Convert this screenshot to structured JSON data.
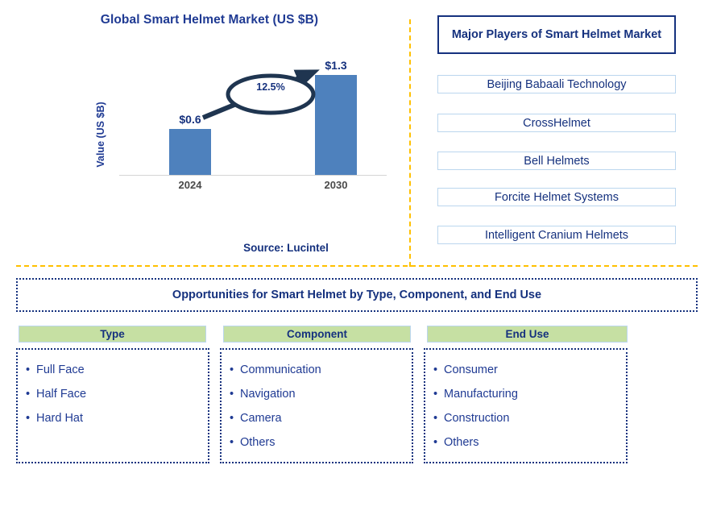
{
  "chart_panel": {
    "title": "Global Smart Helmet Market (US $B)",
    "y_axis_label": "Value (US $B)",
    "cagr_label": "12.5%",
    "source": "Source: Lucintel"
  },
  "chart_data": {
    "type": "bar",
    "title": "Global Smart Helmet Market (US $B)",
    "categories": [
      "2024",
      "2030"
    ],
    "values": [
      0.6,
      1.3
    ],
    "value_labels": [
      "$0.6",
      "$1.3"
    ],
    "xlabel": "",
    "ylabel": "Value (US $B)",
    "ylim": [
      0,
      1.55
    ],
    "grid": false,
    "legend": "none",
    "annotations": [
      {
        "text": "12.5%",
        "type": "cagr-arrow",
        "description": "Upward arrow from 2024 bar to 2030 bar with ellipse callout"
      }
    ],
    "series": [
      {
        "name": "Market Value",
        "values": [
          0.6,
          1.3
        ]
      }
    ],
    "bar_color": "#4E81BD"
  },
  "players_panel": {
    "header": "Major Players of Smart Helmet Market",
    "items": [
      "Beijing Babaali Technology",
      "CrossHelmet",
      "Bell Helmets",
      "Forcite Helmet Systems",
      "Intelligent Cranium Helmets"
    ]
  },
  "opportunities": {
    "banner": "Opportunities for Smart Helmet by Type, Component, and End Use",
    "columns": [
      {
        "header": "Type",
        "items": [
          "Full Face",
          "Half Face",
          "Hard Hat"
        ]
      },
      {
        "header": "Component",
        "items": [
          "Communication",
          "Navigation",
          "Camera",
          "Others"
        ]
      },
      {
        "header": "End Use",
        "items": [
          "Consumer",
          "Manufacturing",
          "Construction",
          "Others"
        ]
      }
    ]
  },
  "colors": {
    "navy": "#15317E",
    "bar_blue": "#4E81BD",
    "divider_orange": "#FFC000",
    "header_green": "#C6E0A3",
    "box_border_blue": "#BBD6EE"
  }
}
